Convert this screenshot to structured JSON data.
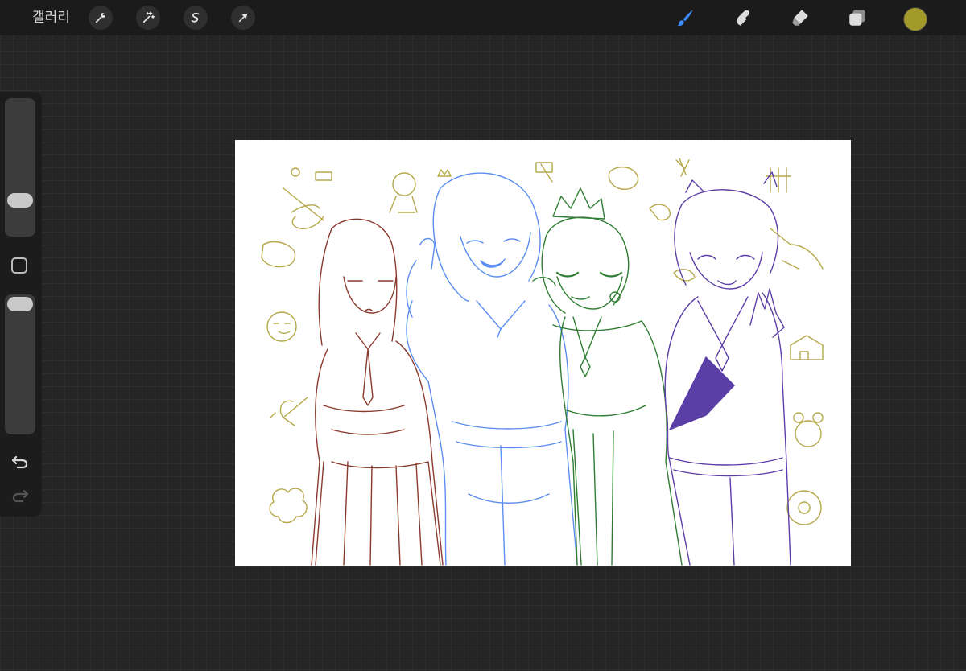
{
  "toolbar": {
    "gallery_label": "갤러리",
    "left_tools": [
      {
        "icon": "wrench-icon",
        "name": "actions"
      },
      {
        "icon": "magic-wand-icon",
        "name": "adjustments"
      },
      {
        "icon": "selection-s-icon",
        "name": "selection"
      },
      {
        "icon": "arrow-cursor-icon",
        "name": "transform"
      }
    ],
    "right_tools": [
      {
        "icon": "brush-icon",
        "name": "paint",
        "active": true
      },
      {
        "icon": "smudge-icon",
        "name": "smudge"
      },
      {
        "icon": "eraser-icon",
        "name": "erase"
      },
      {
        "icon": "layers-icon",
        "name": "layers"
      }
    ],
    "current_color": "#a39a2c",
    "active_tool_color": "#3d8bff"
  },
  "sidebar": {
    "brush_size_level": 0.22,
    "opacity_level": 0.0
  },
  "canvas": {
    "background": "#ffffff",
    "line_colors": {
      "doodles": "#b5a84a",
      "character1": "#8b3a2e",
      "character2": "#5b8ef0",
      "character3": "#2e7d32",
      "character4": "#5b3ea6"
    }
  }
}
